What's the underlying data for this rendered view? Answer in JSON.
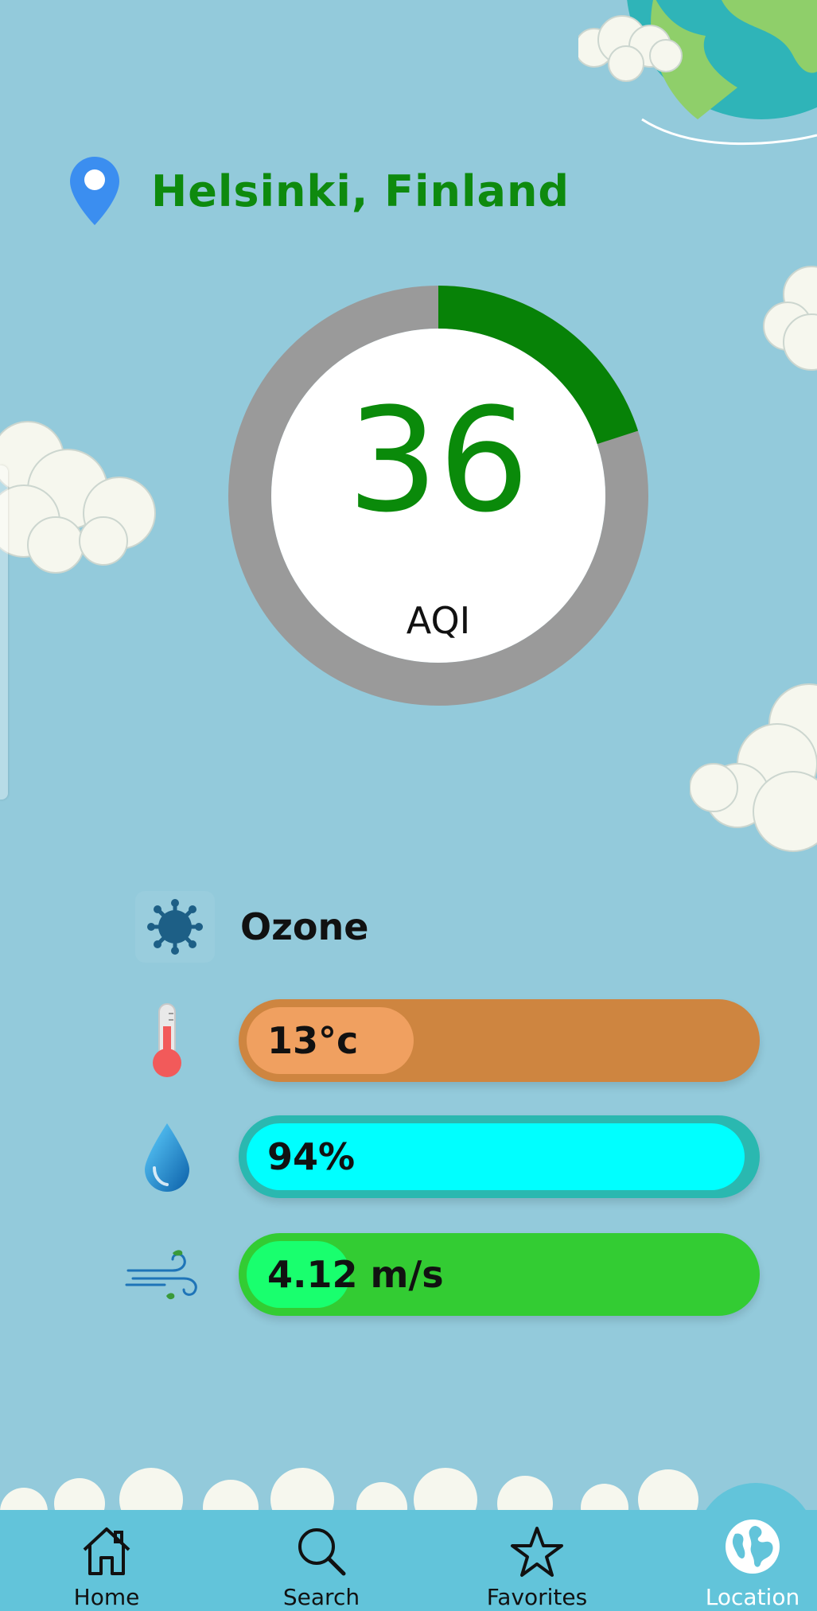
{
  "location": {
    "name": "Helsinki, Finland",
    "icon": "map-pin-icon"
  },
  "aqi": {
    "value": "36",
    "label": "AQI",
    "fraction": 0.2,
    "color": "#078207"
  },
  "pollutant": {
    "name": "Ozone",
    "icon": "virus-icon"
  },
  "metrics": {
    "temperature": {
      "value": "13°c",
      "icon": "thermometer-icon"
    },
    "humidity": {
      "value": "94%",
      "icon": "water-drop-icon"
    },
    "wind": {
      "value": "4.12 m/s",
      "icon": "wind-icon"
    }
  },
  "nav": {
    "items": [
      {
        "label": "Home",
        "icon": "home-icon"
      },
      {
        "label": "Search",
        "icon": "search-icon"
      },
      {
        "label": "Favorites",
        "icon": "star-icon"
      },
      {
        "label": "Location",
        "icon": "globe-icon",
        "active": true
      }
    ]
  },
  "colors": {
    "background": "#93cadb",
    "location_text": "#0e8a0e",
    "nav_background": "#62c4da"
  }
}
